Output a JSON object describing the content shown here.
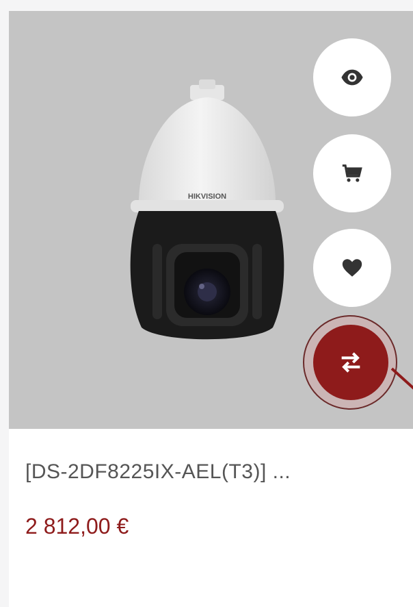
{
  "product": {
    "title": "[DS-2DF8225IX-AEL(T3)] ...",
    "price": "2 812,00 €",
    "brand_logo": "HIKVISION"
  },
  "actions": [
    {
      "name": "quick-view",
      "icon": "eye-icon"
    },
    {
      "name": "add-to-cart",
      "icon": "cart-icon"
    },
    {
      "name": "wishlist",
      "icon": "heart-icon"
    },
    {
      "name": "compare",
      "icon": "swap-arrows-icon"
    }
  ],
  "colors": {
    "accent": "#8e1b1b",
    "image_bg": "#c4c4c4",
    "icon": "#333333",
    "title": "#555555"
  }
}
